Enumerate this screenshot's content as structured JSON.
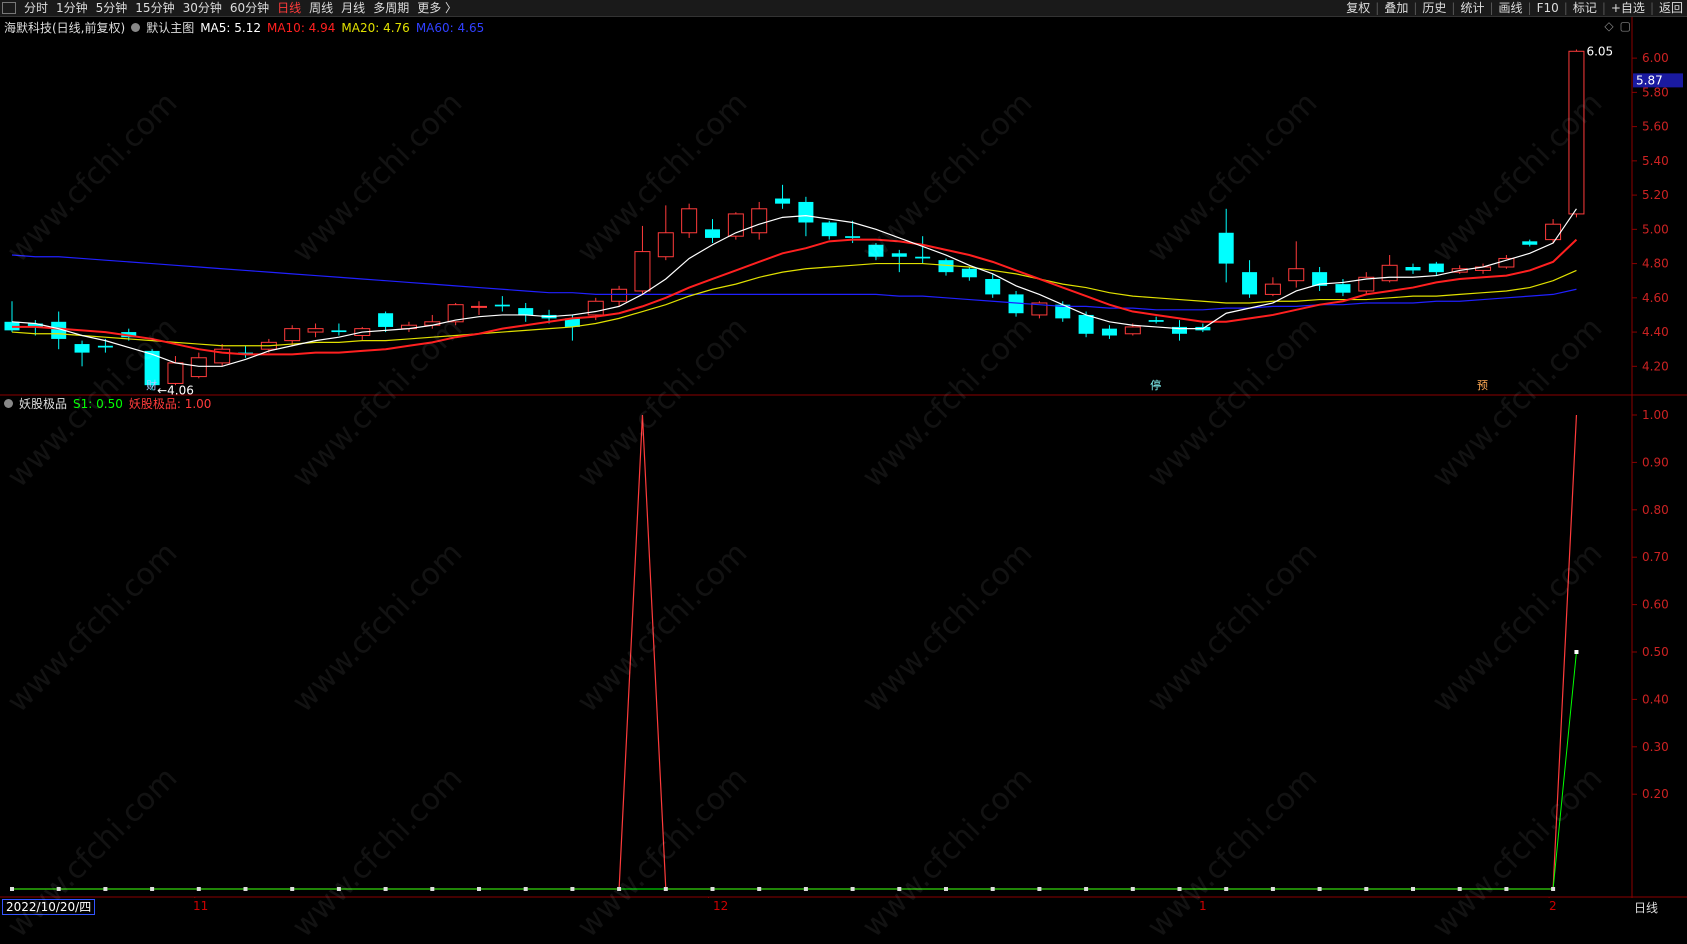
{
  "toolbar": {
    "left": [
      "分时",
      "1分钟",
      "5分钟",
      "15分钟",
      "30分钟",
      "60分钟",
      "日线",
      "周线",
      "月线",
      "多周期",
      "更多 〉"
    ],
    "active": "日线",
    "right": [
      "复权",
      "叠加",
      "历史",
      "统计",
      "画线",
      "F10",
      "标记",
      "+自选",
      "返回"
    ]
  },
  "main_legend": {
    "stock": "海默科技(日线,前复权)",
    "template": "默认主图",
    "ma5": "MA5: 5.12",
    "ma10": "MA10: 4.94",
    "ma20": "MA20: 4.76",
    "ma60": "MA60: 4.65"
  },
  "indicator_legend": {
    "name": "妖股极品",
    "s1": "S1: 0.50",
    "signal": "妖股极品: 1.00"
  },
  "labels": {
    "low": "4.06",
    "high": "6.05",
    "current": "5.87",
    "marker1": "财",
    "marker2": "停",
    "marker3": "预"
  },
  "footer": {
    "date": "2022/10/20/四",
    "period": "日线",
    "months": [
      "11",
      "12",
      "1",
      "2"
    ]
  },
  "watermark": "www.cfchi.com",
  "colors": {
    "up": "#ff3b3b",
    "down": "#00ffff",
    "ma5": "#ffffff",
    "ma10": "#ff2020",
    "ma20": "#e0e000",
    "ma60": "#2020ff",
    "s1": "#00ff00",
    "signal": "#ff3b3b"
  },
  "chart_data": [
    {
      "type": "candlestick",
      "title": "海默科技(日线,前复权)",
      "ylim": [
        4.05,
        6.1
      ],
      "y_ticks": [
        4.2,
        4.4,
        4.6,
        4.8,
        5.0,
        5.2,
        5.4,
        5.6,
        5.8,
        6.0
      ],
      "candles": [
        {
          "o": 4.46,
          "c": 4.41,
          "h": 4.58,
          "l": 4.4
        },
        {
          "o": 4.45,
          "c": 4.43,
          "h": 4.47,
          "l": 4.38
        },
        {
          "o": 4.46,
          "c": 4.36,
          "h": 4.52,
          "l": 4.3
        },
        {
          "o": 4.33,
          "c": 4.28,
          "h": 4.35,
          "l": 4.2
        },
        {
          "o": 4.32,
          "c": 4.31,
          "h": 4.36,
          "l": 4.28
        },
        {
          "o": 4.4,
          "c": 4.37,
          "h": 4.42,
          "l": 4.35
        },
        {
          "o": 4.29,
          "c": 4.09,
          "h": 4.3,
          "l": 4.06
        },
        {
          "o": 4.1,
          "c": 4.22,
          "h": 4.26,
          "l": 4.09
        },
        {
          "o": 4.14,
          "c": 4.25,
          "h": 4.28,
          "l": 4.13
        },
        {
          "o": 4.22,
          "c": 4.3,
          "h": 4.33,
          "l": 4.2
        },
        {
          "o": 4.28,
          "c": 4.27,
          "h": 4.32,
          "l": 4.25
        },
        {
          "o": 4.3,
          "c": 4.34,
          "h": 4.36,
          "l": 4.28
        },
        {
          "o": 4.35,
          "c": 4.42,
          "h": 4.44,
          "l": 4.32
        },
        {
          "o": 4.4,
          "c": 4.42,
          "h": 4.45,
          "l": 4.37
        },
        {
          "o": 4.41,
          "c": 4.4,
          "h": 4.45,
          "l": 4.38
        },
        {
          "o": 4.38,
          "c": 4.42,
          "h": 4.43,
          "l": 4.35
        },
        {
          "o": 4.51,
          "c": 4.43,
          "h": 4.52,
          "l": 4.4
        },
        {
          "o": 4.42,
          "c": 4.44,
          "h": 4.46,
          "l": 4.4
        },
        {
          "o": 4.44,
          "c": 4.46,
          "h": 4.5,
          "l": 4.42
        },
        {
          "o": 4.46,
          "c": 4.56,
          "h": 4.57,
          "l": 4.44
        },
        {
          "o": 4.55,
          "c": 4.55,
          "h": 4.58,
          "l": 4.5
        },
        {
          "o": 4.56,
          "c": 4.55,
          "h": 4.61,
          "l": 4.52
        },
        {
          "o": 4.54,
          "c": 4.5,
          "h": 4.57,
          "l": 4.46
        },
        {
          "o": 4.5,
          "c": 4.48,
          "h": 4.53,
          "l": 4.45
        },
        {
          "o": 4.48,
          "c": 4.43,
          "h": 4.5,
          "l": 4.35
        },
        {
          "o": 4.5,
          "c": 4.58,
          "h": 4.6,
          "l": 4.47
        },
        {
          "o": 4.58,
          "c": 4.65,
          "h": 4.67,
          "l": 4.55
        },
        {
          "o": 4.64,
          "c": 4.87,
          "h": 5.02,
          "l": 4.62
        },
        {
          "o": 4.84,
          "c": 4.98,
          "h": 5.14,
          "l": 4.82
        },
        {
          "o": 4.98,
          "c": 5.12,
          "h": 5.15,
          "l": 4.95
        },
        {
          "o": 5.0,
          "c": 4.95,
          "h": 5.06,
          "l": 4.92
        },
        {
          "o": 4.96,
          "c": 5.09,
          "h": 5.1,
          "l": 4.94
        },
        {
          "o": 4.98,
          "c": 5.12,
          "h": 5.16,
          "l": 4.94
        },
        {
          "o": 5.18,
          "c": 5.15,
          "h": 5.26,
          "l": 5.12
        },
        {
          "o": 5.16,
          "c": 5.04,
          "h": 5.19,
          "l": 4.96
        },
        {
          "o": 5.04,
          "c": 4.96,
          "h": 5.05,
          "l": 4.94
        },
        {
          "o": 4.96,
          "c": 4.95,
          "h": 5.05,
          "l": 4.92
        },
        {
          "o": 4.91,
          "c": 4.84,
          "h": 4.92,
          "l": 4.82
        },
        {
          "o": 4.86,
          "c": 4.84,
          "h": 4.88,
          "l": 4.75
        },
        {
          "o": 4.84,
          "c": 4.83,
          "h": 4.96,
          "l": 4.8
        },
        {
          "o": 4.82,
          "c": 4.75,
          "h": 4.83,
          "l": 4.73
        },
        {
          "o": 4.77,
          "c": 4.72,
          "h": 4.78,
          "l": 4.7
        },
        {
          "o": 4.71,
          "c": 4.62,
          "h": 4.74,
          "l": 4.6
        },
        {
          "o": 4.62,
          "c": 4.51,
          "h": 4.64,
          "l": 4.49
        },
        {
          "o": 4.5,
          "c": 4.57,
          "h": 4.58,
          "l": 4.48
        },
        {
          "o": 4.56,
          "c": 4.48,
          "h": 4.58,
          "l": 4.46
        },
        {
          "o": 4.5,
          "c": 4.39,
          "h": 4.52,
          "l": 4.37
        },
        {
          "o": 4.42,
          "c": 4.38,
          "h": 4.44,
          "l": 4.36
        },
        {
          "o": 4.39,
          "c": 4.43,
          "h": 4.45,
          "l": 4.38
        },
        {
          "o": 4.47,
          "c": 4.46,
          "h": 4.49,
          "l": 4.45
        },
        {
          "o": 4.43,
          "c": 4.39,
          "h": 4.47,
          "l": 4.35
        },
        {
          "o": 4.43,
          "c": 4.41,
          "h": 4.45,
          "l": 4.4
        },
        {
          "o": 4.98,
          "c": 4.8,
          "h": 5.12,
          "l": 4.69
        },
        {
          "o": 4.75,
          "c": 4.62,
          "h": 4.82,
          "l": 4.6
        },
        {
          "o": 4.62,
          "c": 4.68,
          "h": 4.72,
          "l": 4.61
        },
        {
          "o": 4.7,
          "c": 4.77,
          "h": 4.93,
          "l": 4.66
        },
        {
          "o": 4.75,
          "c": 4.67,
          "h": 4.78,
          "l": 4.64
        },
        {
          "o": 4.68,
          "c": 4.63,
          "h": 4.71,
          "l": 4.61
        },
        {
          "o": 4.64,
          "c": 4.72,
          "h": 4.75,
          "l": 4.62
        },
        {
          "o": 4.7,
          "c": 4.79,
          "h": 4.85,
          "l": 4.69
        },
        {
          "o": 4.78,
          "c": 4.76,
          "h": 4.8,
          "l": 4.74
        },
        {
          "o": 4.8,
          "c": 4.75,
          "h": 4.81,
          "l": 4.73
        },
        {
          "o": 4.75,
          "c": 4.77,
          "h": 4.79,
          "l": 4.74
        },
        {
          "o": 4.76,
          "c": 4.78,
          "h": 4.8,
          "l": 4.74
        },
        {
          "o": 4.78,
          "c": 4.83,
          "h": 4.85,
          "l": 4.77
        },
        {
          "o": 4.93,
          "c": 4.91,
          "h": 4.94,
          "l": 4.9
        },
        {
          "o": 4.94,
          "c": 5.03,
          "h": 5.06,
          "l": 4.92
        },
        {
          "o": 5.09,
          "c": 6.04,
          "h": 6.05,
          "l": 5.07
        }
      ],
      "ma5": [
        4.46,
        4.45,
        4.42,
        4.38,
        4.35,
        4.31,
        4.27,
        4.22,
        4.2,
        4.2,
        4.24,
        4.29,
        4.32,
        4.35,
        4.37,
        4.4,
        4.41,
        4.42,
        4.44,
        4.47,
        4.49,
        4.5,
        4.5,
        4.49,
        4.5,
        4.52,
        4.55,
        4.62,
        4.71,
        4.83,
        4.91,
        4.98,
        5.03,
        5.07,
        5.08,
        5.06,
        5.04,
        5.0,
        4.95,
        4.9,
        4.85,
        4.79,
        4.74,
        4.67,
        4.62,
        4.56,
        4.5,
        4.46,
        4.44,
        4.43,
        4.42,
        4.42,
        4.51,
        4.54,
        4.57,
        4.64,
        4.68,
        4.69,
        4.71,
        4.72,
        4.72,
        4.73,
        4.76,
        4.78,
        4.82,
        4.86,
        4.92,
        5.12
      ],
      "ma10": [
        4.43,
        4.43,
        4.42,
        4.41,
        4.4,
        4.38,
        4.36,
        4.33,
        4.3,
        4.28,
        4.27,
        4.27,
        4.27,
        4.28,
        4.28,
        4.29,
        4.3,
        4.32,
        4.34,
        4.37,
        4.39,
        4.42,
        4.44,
        4.46,
        4.48,
        4.49,
        4.51,
        4.55,
        4.6,
        4.66,
        4.71,
        4.76,
        4.81,
        4.86,
        4.89,
        4.93,
        4.94,
        4.94,
        4.93,
        4.91,
        4.88,
        4.85,
        4.81,
        4.76,
        4.71,
        4.66,
        4.61,
        4.56,
        4.52,
        4.5,
        4.48,
        4.46,
        4.46,
        4.48,
        4.5,
        4.53,
        4.56,
        4.58,
        4.62,
        4.64,
        4.66,
        4.69,
        4.71,
        4.72,
        4.73,
        4.76,
        4.81,
        4.94
      ],
      "ma20": [
        4.4,
        4.39,
        4.39,
        4.38,
        4.37,
        4.36,
        4.35,
        4.34,
        4.33,
        4.32,
        4.32,
        4.32,
        4.33,
        4.34,
        4.34,
        4.35,
        4.35,
        4.36,
        4.37,
        4.38,
        4.39,
        4.4,
        4.41,
        4.42,
        4.43,
        4.45,
        4.48,
        4.52,
        4.56,
        4.61,
        4.65,
        4.68,
        4.72,
        4.75,
        4.77,
        4.78,
        4.79,
        4.8,
        4.8,
        4.8,
        4.79,
        4.78,
        4.76,
        4.74,
        4.71,
        4.68,
        4.66,
        4.63,
        4.61,
        4.6,
        4.59,
        4.58,
        4.57,
        4.57,
        4.58,
        4.58,
        4.59,
        4.59,
        4.59,
        4.6,
        4.61,
        4.61,
        4.62,
        4.63,
        4.64,
        4.66,
        4.7,
        4.76
      ],
      "ma60": [
        4.85,
        4.84,
        4.84,
        4.83,
        4.82,
        4.81,
        4.8,
        4.79,
        4.78,
        4.77,
        4.76,
        4.75,
        4.74,
        4.73,
        4.72,
        4.71,
        4.7,
        4.69,
        4.68,
        4.67,
        4.66,
        4.65,
        4.64,
        4.63,
        4.63,
        4.62,
        4.62,
        4.62,
        4.62,
        4.62,
        4.62,
        4.62,
        4.62,
        4.62,
        4.62,
        4.62,
        4.62,
        4.62,
        4.61,
        4.61,
        4.6,
        4.59,
        4.58,
        4.57,
        4.56,
        4.55,
        4.55,
        4.54,
        4.54,
        4.53,
        4.53,
        4.53,
        4.54,
        4.54,
        4.55,
        4.55,
        4.56,
        4.56,
        4.57,
        4.57,
        4.57,
        4.58,
        4.58,
        4.59,
        4.6,
        4.61,
        4.62,
        4.65
      ],
      "current_price": 5.87
    },
    {
      "type": "line",
      "title": "妖股极品",
      "ylim": [
        0,
        1.05
      ],
      "y_ticks": [
        0.2,
        0.3,
        0.4,
        0.5,
        0.6,
        0.7,
        0.8,
        0.9,
        1.0
      ],
      "series": [
        {
          "name": "S1",
          "values": [
            0,
            0,
            0,
            0,
            0,
            0,
            0,
            0,
            0,
            0,
            0,
            0,
            0,
            0,
            0,
            0,
            0,
            0,
            0,
            0,
            0,
            0,
            0,
            0,
            0,
            0,
            0,
            0,
            0,
            0,
            0,
            0,
            0,
            0,
            0,
            0,
            0,
            0,
            0,
            0,
            0,
            0,
            0,
            0,
            0,
            0,
            0,
            0,
            0,
            0,
            0,
            0,
            0,
            0,
            0,
            0,
            0,
            0,
            0,
            0,
            0,
            0,
            0,
            0,
            0,
            0,
            0,
            0.5
          ]
        },
        {
          "name": "妖股极品",
          "values": [
            0,
            0,
            0,
            0,
            0,
            0,
            0,
            0,
            0,
            0,
            0,
            0,
            0,
            0,
            0,
            0,
            0,
            0,
            0,
            0,
            0,
            0,
            0,
            0,
            0,
            0,
            0,
            1,
            0,
            0,
            0,
            0,
            0,
            0,
            0,
            0,
            0,
            0,
            0,
            0,
            0,
            0,
            0,
            0,
            0,
            0,
            0,
            0,
            0,
            0,
            0,
            0,
            0,
            0,
            0,
            0,
            0,
            0,
            0,
            0,
            0,
            0,
            0,
            0,
            0,
            0,
            0,
            1
          ]
        }
      ]
    }
  ]
}
